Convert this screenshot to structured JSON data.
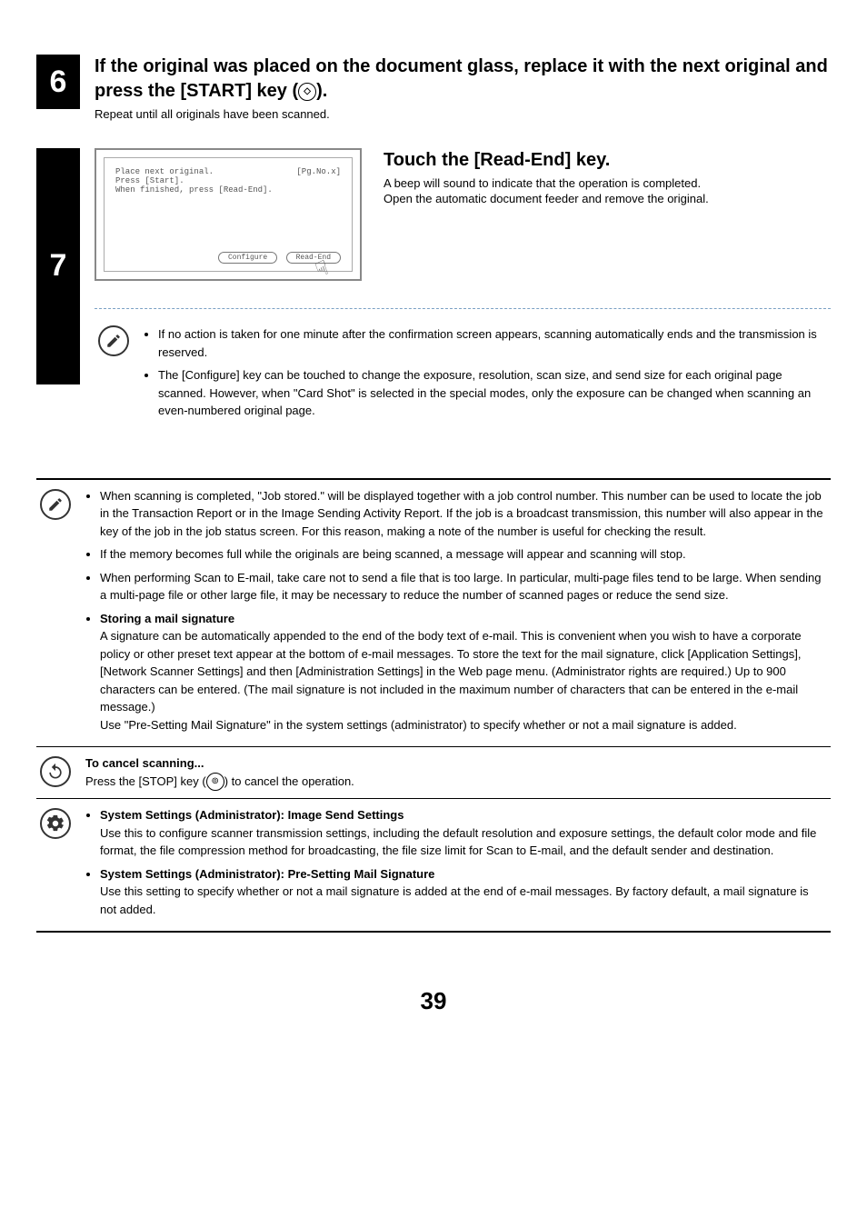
{
  "step6": {
    "number": "6",
    "title_part1": "If the original was placed on the document glass, replace it with the next original and press the [START] key (",
    "title_part2": ").",
    "sub": "Repeat until all originals have been scanned."
  },
  "step7": {
    "number": "7",
    "lcd": {
      "line1": "Place next original.",
      "pg": "[Pg.No.x]",
      "line2": "Press [Start].",
      "line3": "When finished, press [Read-End].",
      "btn_configure": "Configure",
      "btn_readend": "Read-End"
    },
    "title": "Touch the [Read-End] key.",
    "desc1": "A beep will sound to indicate that the operation is completed.",
    "desc2": "Open the automatic document feeder and remove the original.",
    "note1": "If no action is taken for one minute after the confirmation screen appears, scanning automatically ends and the transmission is reserved.",
    "note2": "The [Configure] key can be touched to change the exposure, resolution, scan size, and send size for each original page scanned. However, when \"Card Shot\" is selected in the special modes, only the exposure can be changed when scanning an even-numbered original page."
  },
  "infobox": {
    "b1": "When scanning is completed, \"Job stored.\" will be displayed together with a job control number. This number can be used to locate the job in the Transaction Report or in the Image Sending Activity Report. If the job is a broadcast transmission, this number will also appear in the key of the job in the job status screen. For this reason, making a note of the number is useful for checking the result.",
    "b2": "If the memory becomes full while the originals are being scanned, a message will appear and scanning will stop.",
    "b3": "When performing Scan to E-mail, take care not to send a file that is too large. In particular, multi-page files tend to be large. When sending a multi-page file or other large file, it may be necessary to reduce the number of scanned pages or reduce the send size.",
    "b4_title": "Storing a mail signature",
    "b4_body": "A signature can be automatically appended to the end of the body text of e-mail. This is convenient when you wish to have a corporate policy or other preset text appear at the bottom of e-mail messages. To store the text for the mail signature, click [Application Settings], [Network Scanner Settings] and then [Administration Settings] in the Web page menu. (Administrator rights are required.) Up to 900 characters can be entered. (The mail signature is not included in the maximum number of characters that can be entered in the e-mail message.)\nUse \"Pre-Setting Mail Signature\" in the system settings (administrator) to specify whether or not a mail signature is added."
  },
  "cancel": {
    "title": "To cancel scanning...",
    "body_pre": "Press the [STOP] key (",
    "body_post": ") to cancel the operation."
  },
  "settings": {
    "s1_title": "System Settings (Administrator): Image Send Settings",
    "s1_body": "Use this to configure scanner transmission settings, including the default resolution and exposure settings, the default color mode and file format, the file compression method for broadcasting, the file size limit for Scan to E-mail, and the default sender and destination.",
    "s2_title": "System Settings (Administrator): Pre-Setting Mail Signature",
    "s2_body": "Use this setting to specify whether or not a mail signature is added at the end of e-mail messages. By factory default, a mail signature is not added."
  },
  "page_number": "39"
}
